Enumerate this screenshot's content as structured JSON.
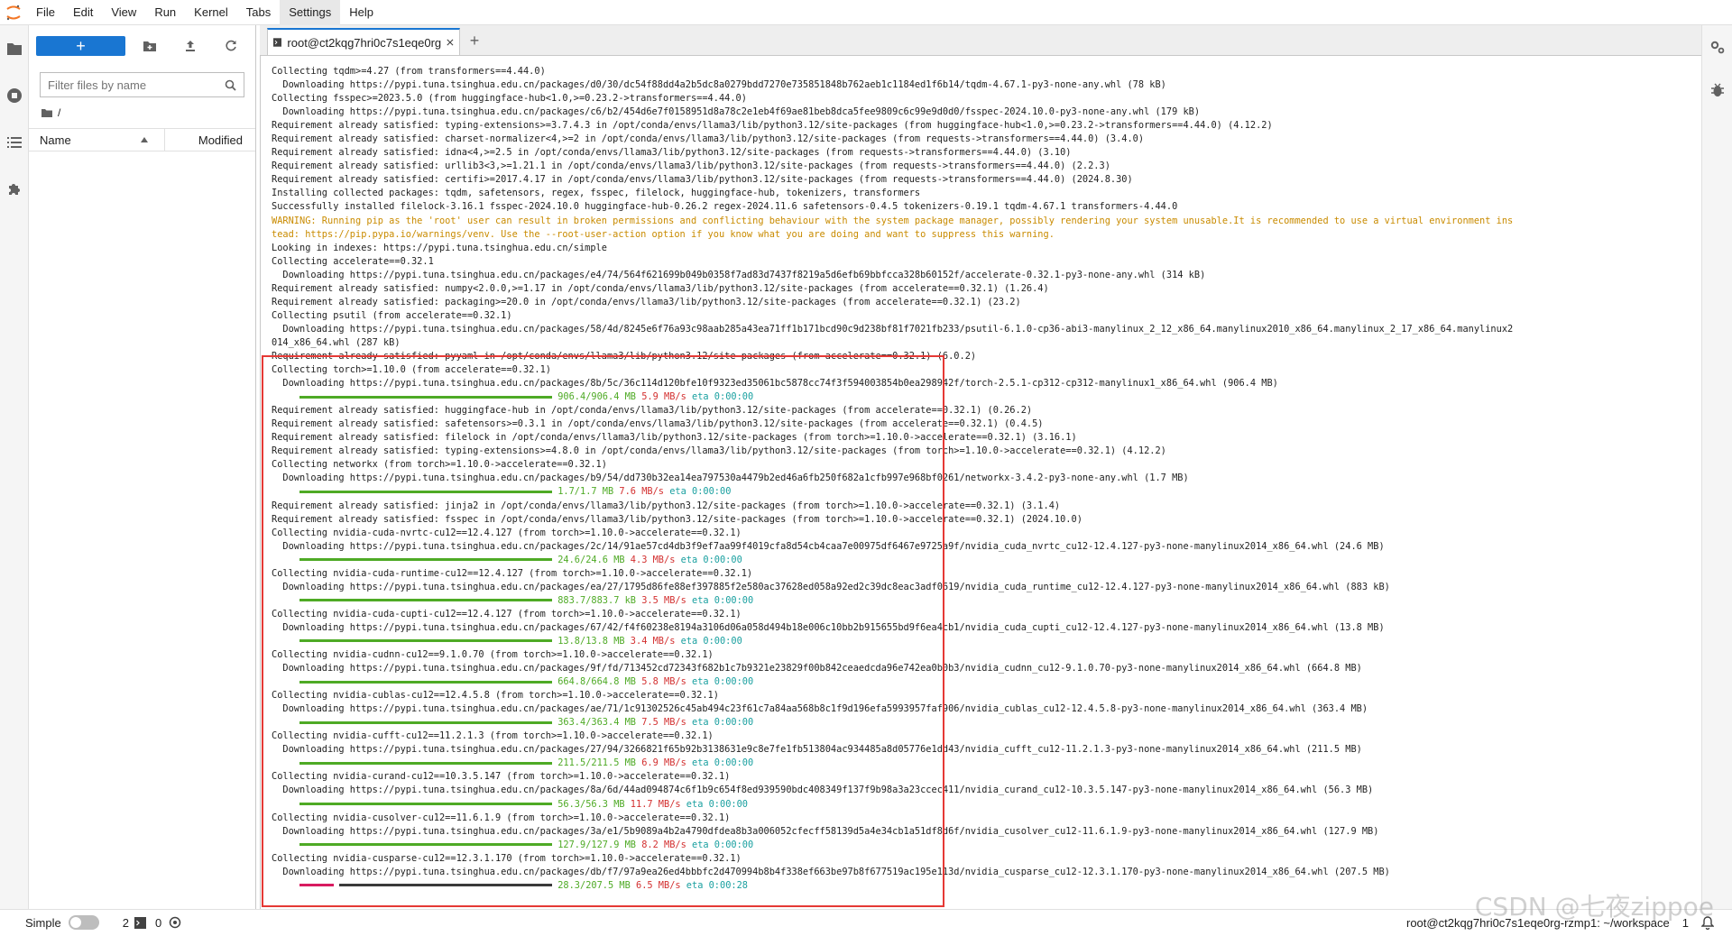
{
  "menubar": {
    "items": [
      "File",
      "Edit",
      "View",
      "Run",
      "Kernel",
      "Tabs",
      "Settings",
      "Help"
    ],
    "active_index": 6
  },
  "filebrowser": {
    "new_label": "+",
    "filter_placeholder": "Filter files by name",
    "path": "/",
    "col_name": "Name",
    "col_modified": "Modified"
  },
  "tabs": {
    "terminal_title": "root@ct2kqg7hri0c7s1eqe0rg",
    "add_label": "+"
  },
  "terminal": {
    "lines": [
      {
        "t": "Collecting tqdm>=4.27 (from transformers==4.44.0)"
      },
      {
        "t": "  Downloading https://pypi.tuna.tsinghua.edu.cn/packages/d0/30/dc54f88dd4a2b5dc8a0279bdd7270e735851848b762aeb1c1184ed1f6b14/tqdm-4.67.1-py3-none-any.whl (78 kB)"
      },
      {
        "t": "Collecting fsspec>=2023.5.0 (from huggingface-hub<1.0,>=0.23.2->transformers==4.44.0)"
      },
      {
        "t": "  Downloading https://pypi.tuna.tsinghua.edu.cn/packages/c6/b2/454d6e7f0158951d8a78c2e1eb4f69ae81beb8dca5fee9809c6c99e9d0d0/fsspec-2024.10.0-py3-none-any.whl (179 kB)"
      },
      {
        "t": "Requirement already satisfied: typing-extensions>=3.7.4.3 in /opt/conda/envs/llama3/lib/python3.12/site-packages (from huggingface-hub<1.0,>=0.23.2->transformers==4.44.0) (4.12.2)"
      },
      {
        "t": "Requirement already satisfied: charset-normalizer<4,>=2 in /opt/conda/envs/llama3/lib/python3.12/site-packages (from requests->transformers==4.44.0) (3.4.0)"
      },
      {
        "t": "Requirement already satisfied: idna<4,>=2.5 in /opt/conda/envs/llama3/lib/python3.12/site-packages (from requests->transformers==4.44.0) (3.10)"
      },
      {
        "t": "Requirement already satisfied: urllib3<3,>=1.21.1 in /opt/conda/envs/llama3/lib/python3.12/site-packages (from requests->transformers==4.44.0) (2.2.3)"
      },
      {
        "t": "Requirement already satisfied: certifi>=2017.4.17 in /opt/conda/envs/llama3/lib/python3.12/site-packages (from requests->transformers==4.44.0) (2024.8.30)"
      },
      {
        "t": "Installing collected packages: tqdm, safetensors, regex, fsspec, filelock, huggingface-hub, tokenizers, transformers"
      },
      {
        "t": "Successfully installed filelock-3.16.1 fsspec-2024.10.0 huggingface-hub-0.26.2 regex-2024.11.6 safetensors-0.4.5 tokenizers-0.19.1 tqdm-4.67.1 transformers-4.44.0"
      },
      {
        "t": "WARNING: Running pip as the 'root' user can result in broken permissions and conflicting behaviour with the system package manager, possibly rendering your system unusable.It is recommended to use a virtual environment ins",
        "warn": true
      },
      {
        "t": "tead: https://pip.pypa.io/warnings/venv. Use the --root-user-action option if you know what you are doing and want to suppress this warning.",
        "warn": true
      },
      {
        "t": "Looking in indexes: https://pypi.tuna.tsinghua.edu.cn/simple"
      },
      {
        "t": "Collecting accelerate==0.32.1"
      },
      {
        "t": "  Downloading https://pypi.tuna.tsinghua.edu.cn/packages/e4/74/564f621699b049b0358f7ad83d7437f8219a5d6efb69bbfcca328b60152f/accelerate-0.32.1-py3-none-any.whl (314 kB)"
      },
      {
        "t": "Requirement already satisfied: numpy<2.0.0,>=1.17 in /opt/conda/envs/llama3/lib/python3.12/site-packages (from accelerate==0.32.1) (1.26.4)"
      },
      {
        "t": "Requirement already satisfied: packaging>=20.0 in /opt/conda/envs/llama3/lib/python3.12/site-packages (from accelerate==0.32.1) (23.2)"
      },
      {
        "t": "Collecting psutil (from accelerate==0.32.1)"
      },
      {
        "t": "  Downloading https://pypi.tuna.tsinghua.edu.cn/packages/58/4d/8245e6f76a93c98aab285a43ea71ff1b171bcd90c9d238bf81f7021fb233/psutil-6.1.0-cp36-abi3-manylinux_2_12_x86_64.manylinux2010_x86_64.manylinux_2_17_x86_64.manylinux2"
      },
      {
        "t": "014_x86_64.whl (287 kB)"
      },
      {
        "t": "Requirement already satisfied: pyyaml in /opt/conda/envs/llama3/lib/python3.12/site-packages (from accelerate==0.32.1) (6.0.2)"
      },
      {
        "t": "Collecting torch>=1.10.0 (from accelerate==0.32.1)"
      },
      {
        "t": "  Downloading https://pypi.tuna.tsinghua.edu.cn/packages/8b/5c/36c114d120bfe10f9323ed35061bc5878cc74f3f594003854b0ea298942f/torch-2.5.1-cp312-cp312-manylinux1_x86_64.whl (906.4 MB)"
      },
      {
        "progress": 1.0,
        "done": "906.4/906.4 MB",
        "speed": "5.9 MB/s",
        "eta": "0:00:00"
      },
      {
        "t": "Requirement already satisfied: huggingface-hub in /opt/conda/envs/llama3/lib/python3.12/site-packages (from accelerate==0.32.1) (0.26.2)"
      },
      {
        "t": "Requirement already satisfied: safetensors>=0.3.1 in /opt/conda/envs/llama3/lib/python3.12/site-packages (from accelerate==0.32.1) (0.4.5)"
      },
      {
        "t": "Requirement already satisfied: filelock in /opt/conda/envs/llama3/lib/python3.12/site-packages (from torch>=1.10.0->accelerate==0.32.1) (3.16.1)"
      },
      {
        "t": "Requirement already satisfied: typing-extensions>=4.8.0 in /opt/conda/envs/llama3/lib/python3.12/site-packages (from torch>=1.10.0->accelerate==0.32.1) (4.12.2)"
      },
      {
        "t": "Collecting networkx (from torch>=1.10.0->accelerate==0.32.1)"
      },
      {
        "t": "  Downloading https://pypi.tuna.tsinghua.edu.cn/packages/b9/54/dd730b32ea14ea797530a4479b2ed46a6fb250f682a1cfb997e968bf0261/networkx-3.4.2-py3-none-any.whl (1.7 MB)"
      },
      {
        "progress": 1.0,
        "done": "1.7/1.7 MB",
        "speed": "7.6 MB/s",
        "eta": "0:00:00"
      },
      {
        "t": "Requirement already satisfied: jinja2 in /opt/conda/envs/llama3/lib/python3.12/site-packages (from torch>=1.10.0->accelerate==0.32.1) (3.1.4)"
      },
      {
        "t": "Requirement already satisfied: fsspec in /opt/conda/envs/llama3/lib/python3.12/site-packages (from torch>=1.10.0->accelerate==0.32.1) (2024.10.0)"
      },
      {
        "t": "Collecting nvidia-cuda-nvrtc-cu12==12.4.127 (from torch>=1.10.0->accelerate==0.32.1)"
      },
      {
        "t": "  Downloading https://pypi.tuna.tsinghua.edu.cn/packages/2c/14/91ae57cd4db3f9ef7aa99f4019cfa8d54cb4caa7e00975df6467e9725a9f/nvidia_cuda_nvrtc_cu12-12.4.127-py3-none-manylinux2014_x86_64.whl (24.6 MB)"
      },
      {
        "progress": 1.0,
        "done": "24.6/24.6 MB",
        "speed": "4.3 MB/s",
        "eta": "0:00:00"
      },
      {
        "t": "Collecting nvidia-cuda-runtime-cu12==12.4.127 (from torch>=1.10.0->accelerate==0.32.1)"
      },
      {
        "t": "  Downloading https://pypi.tuna.tsinghua.edu.cn/packages/ea/27/1795d86fe88ef397885f2e580ac37628ed058a92ed2c39dc8eac3adf0619/nvidia_cuda_runtime_cu12-12.4.127-py3-none-manylinux2014_x86_64.whl (883 kB)"
      },
      {
        "progress": 1.0,
        "done": "883.7/883.7 kB",
        "speed": "3.5 MB/s",
        "eta": "0:00:00"
      },
      {
        "t": "Collecting nvidia-cuda-cupti-cu12==12.4.127 (from torch>=1.10.0->accelerate==0.32.1)"
      },
      {
        "t": "  Downloading https://pypi.tuna.tsinghua.edu.cn/packages/67/42/f4f60238e8194a3106d06a058d494b18e006c10bb2b915655bd9f6ea4cb1/nvidia_cuda_cupti_cu12-12.4.127-py3-none-manylinux2014_x86_64.whl (13.8 MB)"
      },
      {
        "progress": 1.0,
        "done": "13.8/13.8 MB",
        "speed": "3.4 MB/s",
        "eta": "0:00:00"
      },
      {
        "t": "Collecting nvidia-cudnn-cu12==9.1.0.70 (from torch>=1.10.0->accelerate==0.32.1)"
      },
      {
        "t": "  Downloading https://pypi.tuna.tsinghua.edu.cn/packages/9f/fd/713452cd72343f682b1c7b9321e23829f00b842ceaedcda96e742ea0b0b3/nvidia_cudnn_cu12-9.1.0.70-py3-none-manylinux2014_x86_64.whl (664.8 MB)"
      },
      {
        "progress": 1.0,
        "done": "664.8/664.8 MB",
        "speed": "5.8 MB/s",
        "eta": "0:00:00"
      },
      {
        "t": "Collecting nvidia-cublas-cu12==12.4.5.8 (from torch>=1.10.0->accelerate==0.32.1)"
      },
      {
        "t": "  Downloading https://pypi.tuna.tsinghua.edu.cn/packages/ae/71/1c91302526c45ab494c23f61c7a84aa568b8c1f9d196efa5993957faf906/nvidia_cublas_cu12-12.4.5.8-py3-none-manylinux2014_x86_64.whl (363.4 MB)"
      },
      {
        "progress": 1.0,
        "done": "363.4/363.4 MB",
        "speed": "7.5 MB/s",
        "eta": "0:00:00"
      },
      {
        "t": "Collecting nvidia-cufft-cu12==11.2.1.3 (from torch>=1.10.0->accelerate==0.32.1)"
      },
      {
        "t": "  Downloading https://pypi.tuna.tsinghua.edu.cn/packages/27/94/3266821f65b92b3138631e9c8e7fe1fb513804ac934485a8d05776e1dd43/nvidia_cufft_cu12-11.2.1.3-py3-none-manylinux2014_x86_64.whl (211.5 MB)"
      },
      {
        "progress": 1.0,
        "done": "211.5/211.5 MB",
        "speed": "6.9 MB/s",
        "eta": "0:00:00"
      },
      {
        "t": "Collecting nvidia-curand-cu12==10.3.5.147 (from torch>=1.10.0->accelerate==0.32.1)"
      },
      {
        "t": "  Downloading https://pypi.tuna.tsinghua.edu.cn/packages/8a/6d/44ad094874c6f1b9c654f8ed939590bdc408349f137f9b98a3a23ccec411/nvidia_curand_cu12-10.3.5.147-py3-none-manylinux2014_x86_64.whl (56.3 MB)"
      },
      {
        "progress": 1.0,
        "done": "56.3/56.3 MB",
        "speed": "11.7 MB/s",
        "eta": "0:00:00"
      },
      {
        "t": "Collecting nvidia-cusolver-cu12==11.6.1.9 (from torch>=1.10.0->accelerate==0.32.1)"
      },
      {
        "t": "  Downloading https://pypi.tuna.tsinghua.edu.cn/packages/3a/e1/5b9089a4b2a4790dfdea8b3a006052cfecff58139d5a4e34cb1a51df8d6f/nvidia_cusolver_cu12-11.6.1.9-py3-none-manylinux2014_x86_64.whl (127.9 MB)"
      },
      {
        "progress": 1.0,
        "done": "127.9/127.9 MB",
        "speed": "8.2 MB/s",
        "eta": "0:00:00"
      },
      {
        "t": "Collecting nvidia-cusparse-cu12==12.3.1.170 (from torch>=1.10.0->accelerate==0.32.1)"
      },
      {
        "t": "  Downloading https://pypi.tuna.tsinghua.edu.cn/packages/db/f7/97a9ea26ed4bbbfc2d470994b8b4f338ef663be97b8f677519ac195e113d/nvidia_cusparse_cu12-12.3.1.170-py3-none-manylinux2014_x86_64.whl (207.5 MB)"
      },
      {
        "progress": 0.137,
        "done": "28.3/207.5 MB",
        "speed": "6.5 MB/s",
        "eta": "0:00:28"
      }
    ]
  },
  "statusbar": {
    "mode_label": "Simple",
    "terminals_count": "2",
    "kernels_count": "0",
    "path": "root@ct2kqg7hri0c7s1eqe0rg-rzmp1: ~/workspace",
    "notifications": "1"
  },
  "watermark": "CSDN @七夜zippoe",
  "colors": {
    "accent": "#1976d2",
    "progress_done": "#4eaa25",
    "progress_partial": "#d81b60",
    "warning_text": "#c98b00",
    "highlight_box": "#e53935"
  }
}
